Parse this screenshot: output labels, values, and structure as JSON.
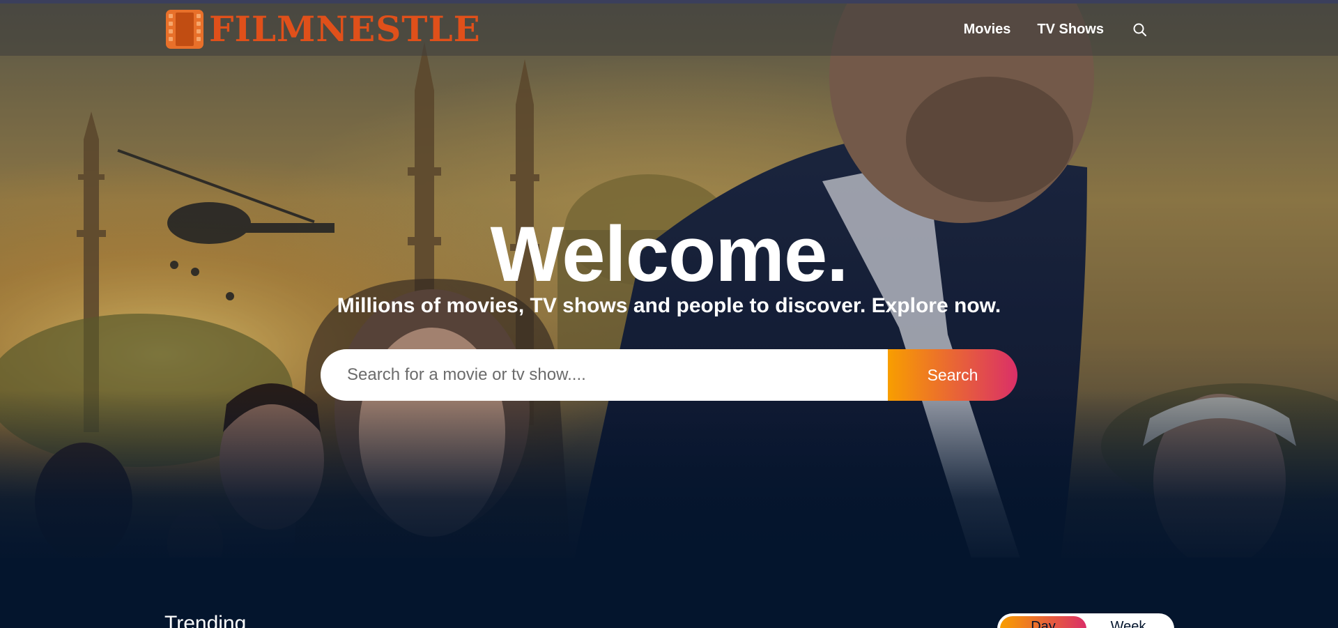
{
  "header": {
    "logo_text": "FILMNESTLE",
    "logo_icon": "film-strip-icon",
    "nav": [
      {
        "label": "Movies"
      },
      {
        "label": "TV Shows"
      }
    ],
    "search_icon": "search-icon"
  },
  "hero": {
    "title": "Welcome.",
    "subtitle": "Millions of movies, TV shows and people to discover. Explore now.",
    "search": {
      "placeholder": "Search for a movie or tv show....",
      "button_label": "Search"
    }
  },
  "trending": {
    "title": "Trending",
    "tabs": [
      "Day",
      "Week"
    ],
    "active_tab": "Day"
  },
  "colors": {
    "background": "#04152d",
    "accent_start": "#f89e00",
    "accent_end": "#da2f68",
    "logo": "#e0501a"
  }
}
